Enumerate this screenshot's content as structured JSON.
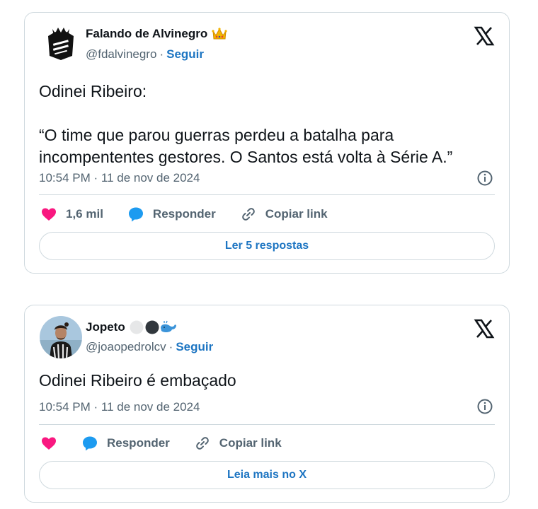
{
  "tweets": [
    {
      "name": "Falando de Alvinegro",
      "badge_icon": "crown-icon",
      "handle": "@fdalvinegro",
      "separator": "·",
      "follow": "Seguir",
      "text": "Odinei Ribeiro:\n\n“O time que parou guerras perdeu a batalha para incompententes gestores. O Santos está volta à Série A.”",
      "time": "10:54 PM · 11 de nov de 2024",
      "likes": "1,6 mil",
      "reply": "Responder",
      "copy_link": "Copiar link",
      "more": "Ler 5 respostas"
    },
    {
      "name": "Jopeto",
      "badge_icon": "circles-whale-icons",
      "handle": "@joaopedrolcv",
      "separator": "·",
      "follow": "Seguir",
      "text": "Odinei Ribeiro é embaçado",
      "time": "10:54 PM · 11 de nov de 2024",
      "reply": "Responder",
      "copy_link": "Copiar link",
      "more": "Leia mais no X"
    }
  ],
  "colors": {
    "link": "#1d75c2",
    "heart": "#f91880",
    "reply": "#1d9bf0",
    "muted": "#536471",
    "border": "#cfd9de"
  }
}
